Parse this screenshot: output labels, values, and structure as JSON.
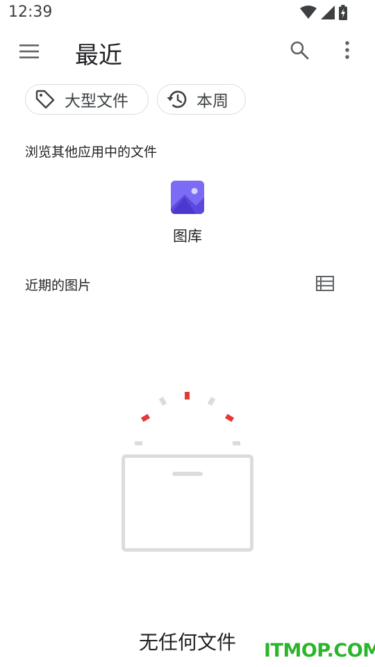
{
  "status_bar": {
    "time": "12:39"
  },
  "app_bar": {
    "title": "最近"
  },
  "chips": [
    {
      "label": "大型文件",
      "icon": "tag-icon"
    },
    {
      "label": "本周",
      "icon": "history-icon"
    }
  ],
  "browse": {
    "heading": "浏览其他应用中的文件",
    "apps": [
      {
        "label": "图库",
        "icon": "gallery-icon"
      }
    ]
  },
  "recent": {
    "heading": "近期的图片"
  },
  "empty_state": {
    "message": "无任何文件"
  },
  "watermark": {
    "text": "ITMOP.COM"
  },
  "colors": {
    "accent_red": "#e53935",
    "chip_border": "#dadce0",
    "gallery_purple": "#7c6cf5",
    "watermark_green": "#2bb52b"
  }
}
